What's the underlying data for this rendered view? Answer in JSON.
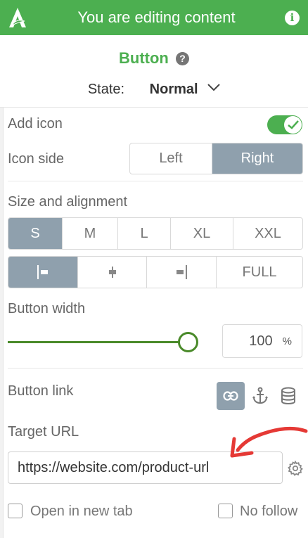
{
  "header": {
    "title": "You are editing content",
    "logo_icon": "brand-a-logo",
    "info_icon": "info-icon",
    "info_glyph": "i",
    "bg_color": "#4caf50"
  },
  "panel": {
    "title": "Button",
    "help_glyph": "?",
    "state_label": "State:",
    "state_value": "Normal"
  },
  "add_icon": {
    "label": "Add icon",
    "enabled": true
  },
  "icon_side": {
    "label": "Icon side",
    "options": [
      "Left",
      "Right"
    ],
    "selected": "Right"
  },
  "size_alignment": {
    "label": "Size and alignment",
    "sizes": [
      "S",
      "M",
      "L",
      "XL",
      "XXL"
    ],
    "selected_size": "S",
    "alignments": [
      {
        "icon": "align-left-icon"
      },
      {
        "icon": "align-center-icon"
      },
      {
        "icon": "align-right-icon"
      },
      {
        "label": "FULL"
      }
    ],
    "selected_alignment": "align-left-icon"
  },
  "button_width": {
    "label": "Button width",
    "value": "100",
    "unit": "%",
    "slider_fraction": 1.0
  },
  "button_link": {
    "label": "Button link",
    "types": [
      "link-icon",
      "anchor-icon",
      "database-icon"
    ],
    "selected": "link-icon"
  },
  "target_url": {
    "label": "Target URL",
    "value": "https://website.com/product-url"
  },
  "options": {
    "new_tab": {
      "label": "Open in new tab",
      "checked": false
    },
    "no_follow": {
      "label": "No follow",
      "checked": false
    }
  },
  "colors": {
    "accent": "#4caf50",
    "active_segment": "#8fa0ad",
    "annotation_arrow": "#e53935"
  }
}
